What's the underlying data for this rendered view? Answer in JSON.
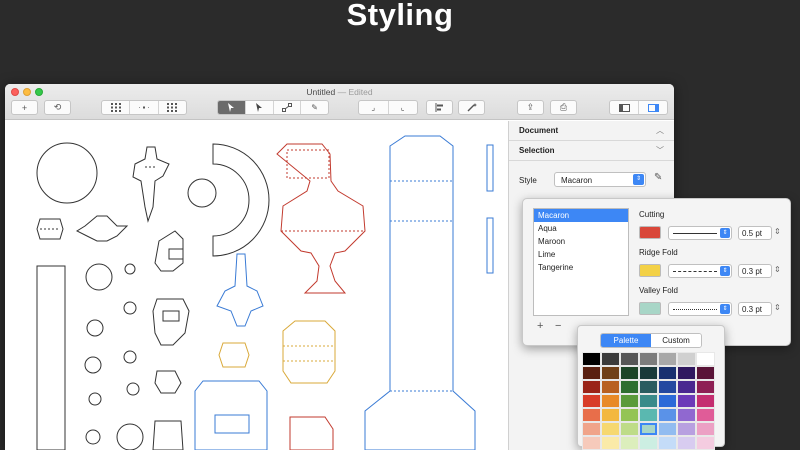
{
  "slide": {
    "title": "Styling"
  },
  "window": {
    "title": "Untitled",
    "status": "— Edited"
  },
  "toolbar": {
    "add": "+",
    "rotate": "⟲",
    "zoom": "⤢",
    "pen": "✎",
    "tool5": "⌟",
    "tool6": "⌞",
    "share": "⇪",
    "print": "⎙"
  },
  "inspector": {
    "document": "Document",
    "selection": "Selection",
    "style_label": "Style",
    "style_value": "Macaron"
  },
  "popover": {
    "styles": [
      "Macaron",
      "Aqua",
      "Maroon",
      "Lime",
      "Tangerine"
    ],
    "selected": 0,
    "add": "+",
    "remove": "−",
    "cutting": {
      "label": "Cutting",
      "color": "#d9473a",
      "value": "0.5 pt",
      "line": "solid"
    },
    "ridge": {
      "label": "Ridge Fold",
      "color": "#f3d146",
      "value": "0.3 pt",
      "line": "dashed"
    },
    "valley": {
      "label": "Valley Fold",
      "color": "#a8d6c7",
      "value": "0.3 pt",
      "line": "dotted"
    }
  },
  "palette": {
    "tabs": [
      "Palette",
      "Custom"
    ],
    "active_tab": 0,
    "selected": [
      5,
      3
    ],
    "colors": [
      [
        "#000000",
        "#3b3b3b",
        "#565656",
        "#7c7c7c",
        "#a8a8a8",
        "#d0d0d0",
        "#ffffff"
      ],
      [
        "#5a2010",
        "#704018",
        "#1c4426",
        "#1a3a3a",
        "#183070",
        "#301860",
        "#5a1438"
      ],
      [
        "#9a2418",
        "#b86020",
        "#2e6e30",
        "#2a5c60",
        "#2448a0",
        "#4a2890",
        "#8e2054"
      ],
      [
        "#d83c28",
        "#e88a28",
        "#5a9a3a",
        "#3a8a8a",
        "#2c6ad8",
        "#6c3ab8",
        "#c42e70"
      ],
      [
        "#e86e4a",
        "#f3b840",
        "#94c454",
        "#5ab8b0",
        "#5a92e8",
        "#9068d0",
        "#e05c98"
      ],
      [
        "#f0a48a",
        "#f6d870",
        "#bedc88",
        "#a8d6c7",
        "#92bcf0",
        "#b8a0e0",
        "#eca0c4"
      ],
      [
        "#f6cabb",
        "#faeaa8",
        "#dceebc",
        "#cceee2",
        "#c4dcf8",
        "#d8ccf0",
        "#f4cce0"
      ]
    ]
  }
}
